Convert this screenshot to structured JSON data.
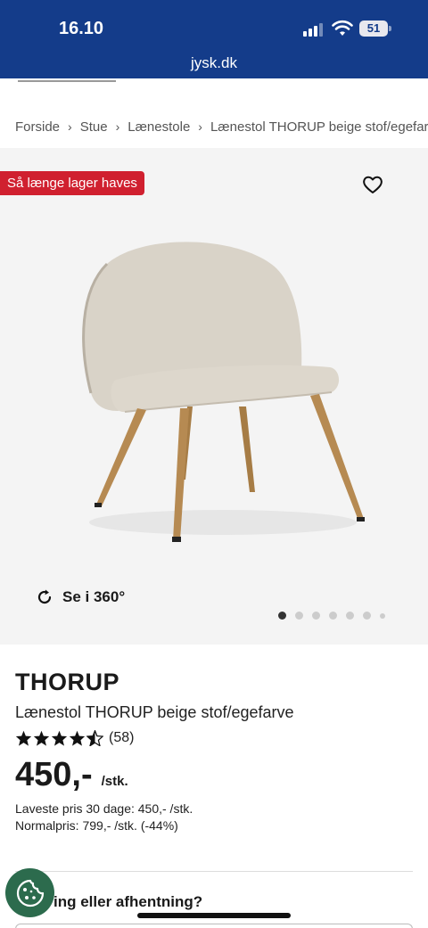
{
  "status_bar": {
    "time": "16.10",
    "battery": "51",
    "url": "jysk.dk"
  },
  "breadcrumb": [
    "Forside",
    "Stue",
    "Lænestole",
    "Lænestol THORUP beige stof/egefarve"
  ],
  "gallery": {
    "badge": "Så længe lager haves",
    "view_360_label": "Se i 360°",
    "image_count": 6,
    "active_index": 0
  },
  "product": {
    "brand": "THORUP",
    "name": "Lænestol THORUP beige stof/egefarve",
    "rating": 4.5,
    "rating_count": "(58)",
    "price": "450,-",
    "unit": "/stk.",
    "lowest_price": "Laveste pris 30 dage: 450,- /stk.",
    "normal_price": "Normalpris: 799,- /stk. (-44%)"
  },
  "delivery": {
    "heading_partial": "ing eller afhentning?"
  },
  "colors": {
    "header": "#143c8a",
    "badge": "#d0202f",
    "cookie": "#2c6b4d"
  },
  "icons": [
    "heart-icon",
    "rotate-360-icon",
    "star-icon",
    "cookie-icon",
    "wifi-icon",
    "cellular-icon"
  ]
}
